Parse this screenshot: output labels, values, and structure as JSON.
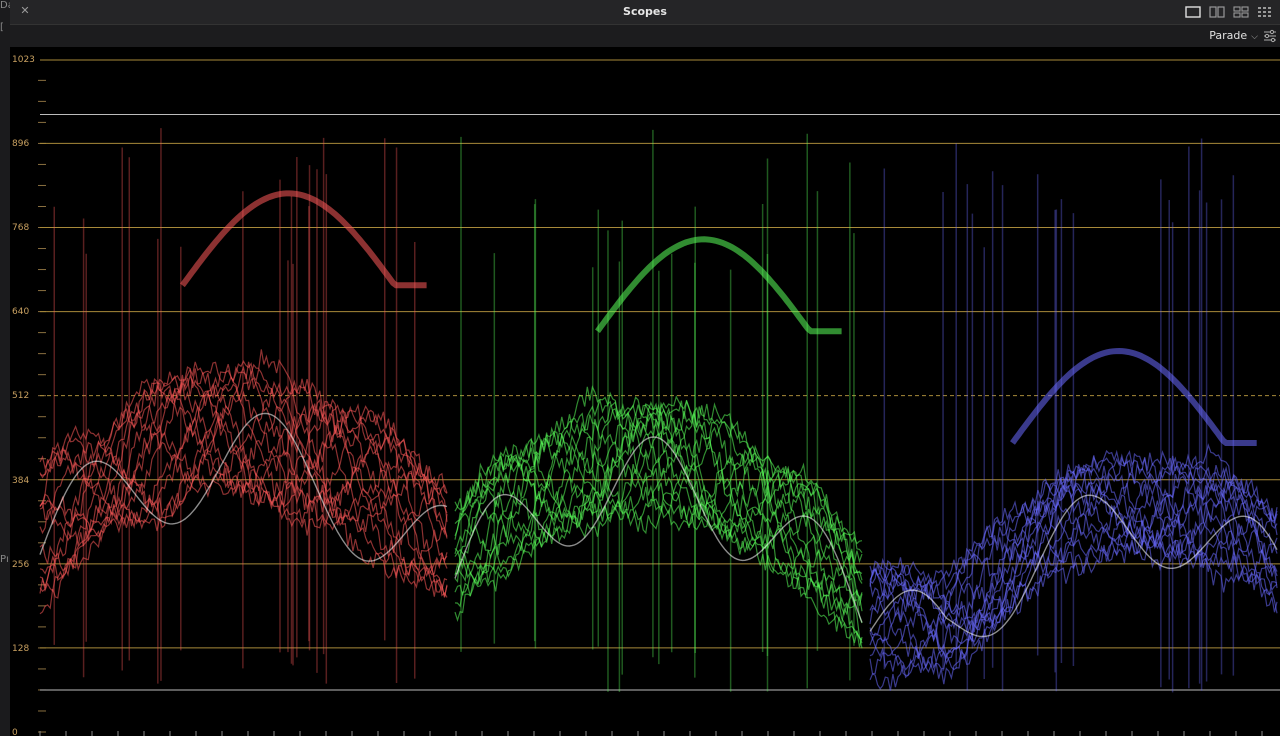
{
  "window": {
    "title": "Scopes",
    "close_icon": "close-icon",
    "layout_icons": [
      "single-view-icon",
      "dual-view-icon",
      "quad-view-icon",
      "grid-view-icon"
    ]
  },
  "toolbar": {
    "mode_label": "Parade",
    "mode_icon": "chevron-down-icon",
    "options_icon": "settings-sliders-icon"
  },
  "left_strip": {
    "fragments": [
      "Da",
      "[",
      "Pı"
    ]
  },
  "scale": {
    "labels": [
      "1023",
      "896",
      "768",
      "640",
      "512",
      "384",
      "256",
      "128",
      "0"
    ],
    "line_color": "#a88a3a",
    "midline_label": "512"
  },
  "channels": [
    {
      "name": "red",
      "color": "#ff5a5a"
    },
    {
      "name": "green",
      "color": "#5aff5a"
    },
    {
      "name": "blue",
      "color": "#6a6aff"
    }
  ]
}
